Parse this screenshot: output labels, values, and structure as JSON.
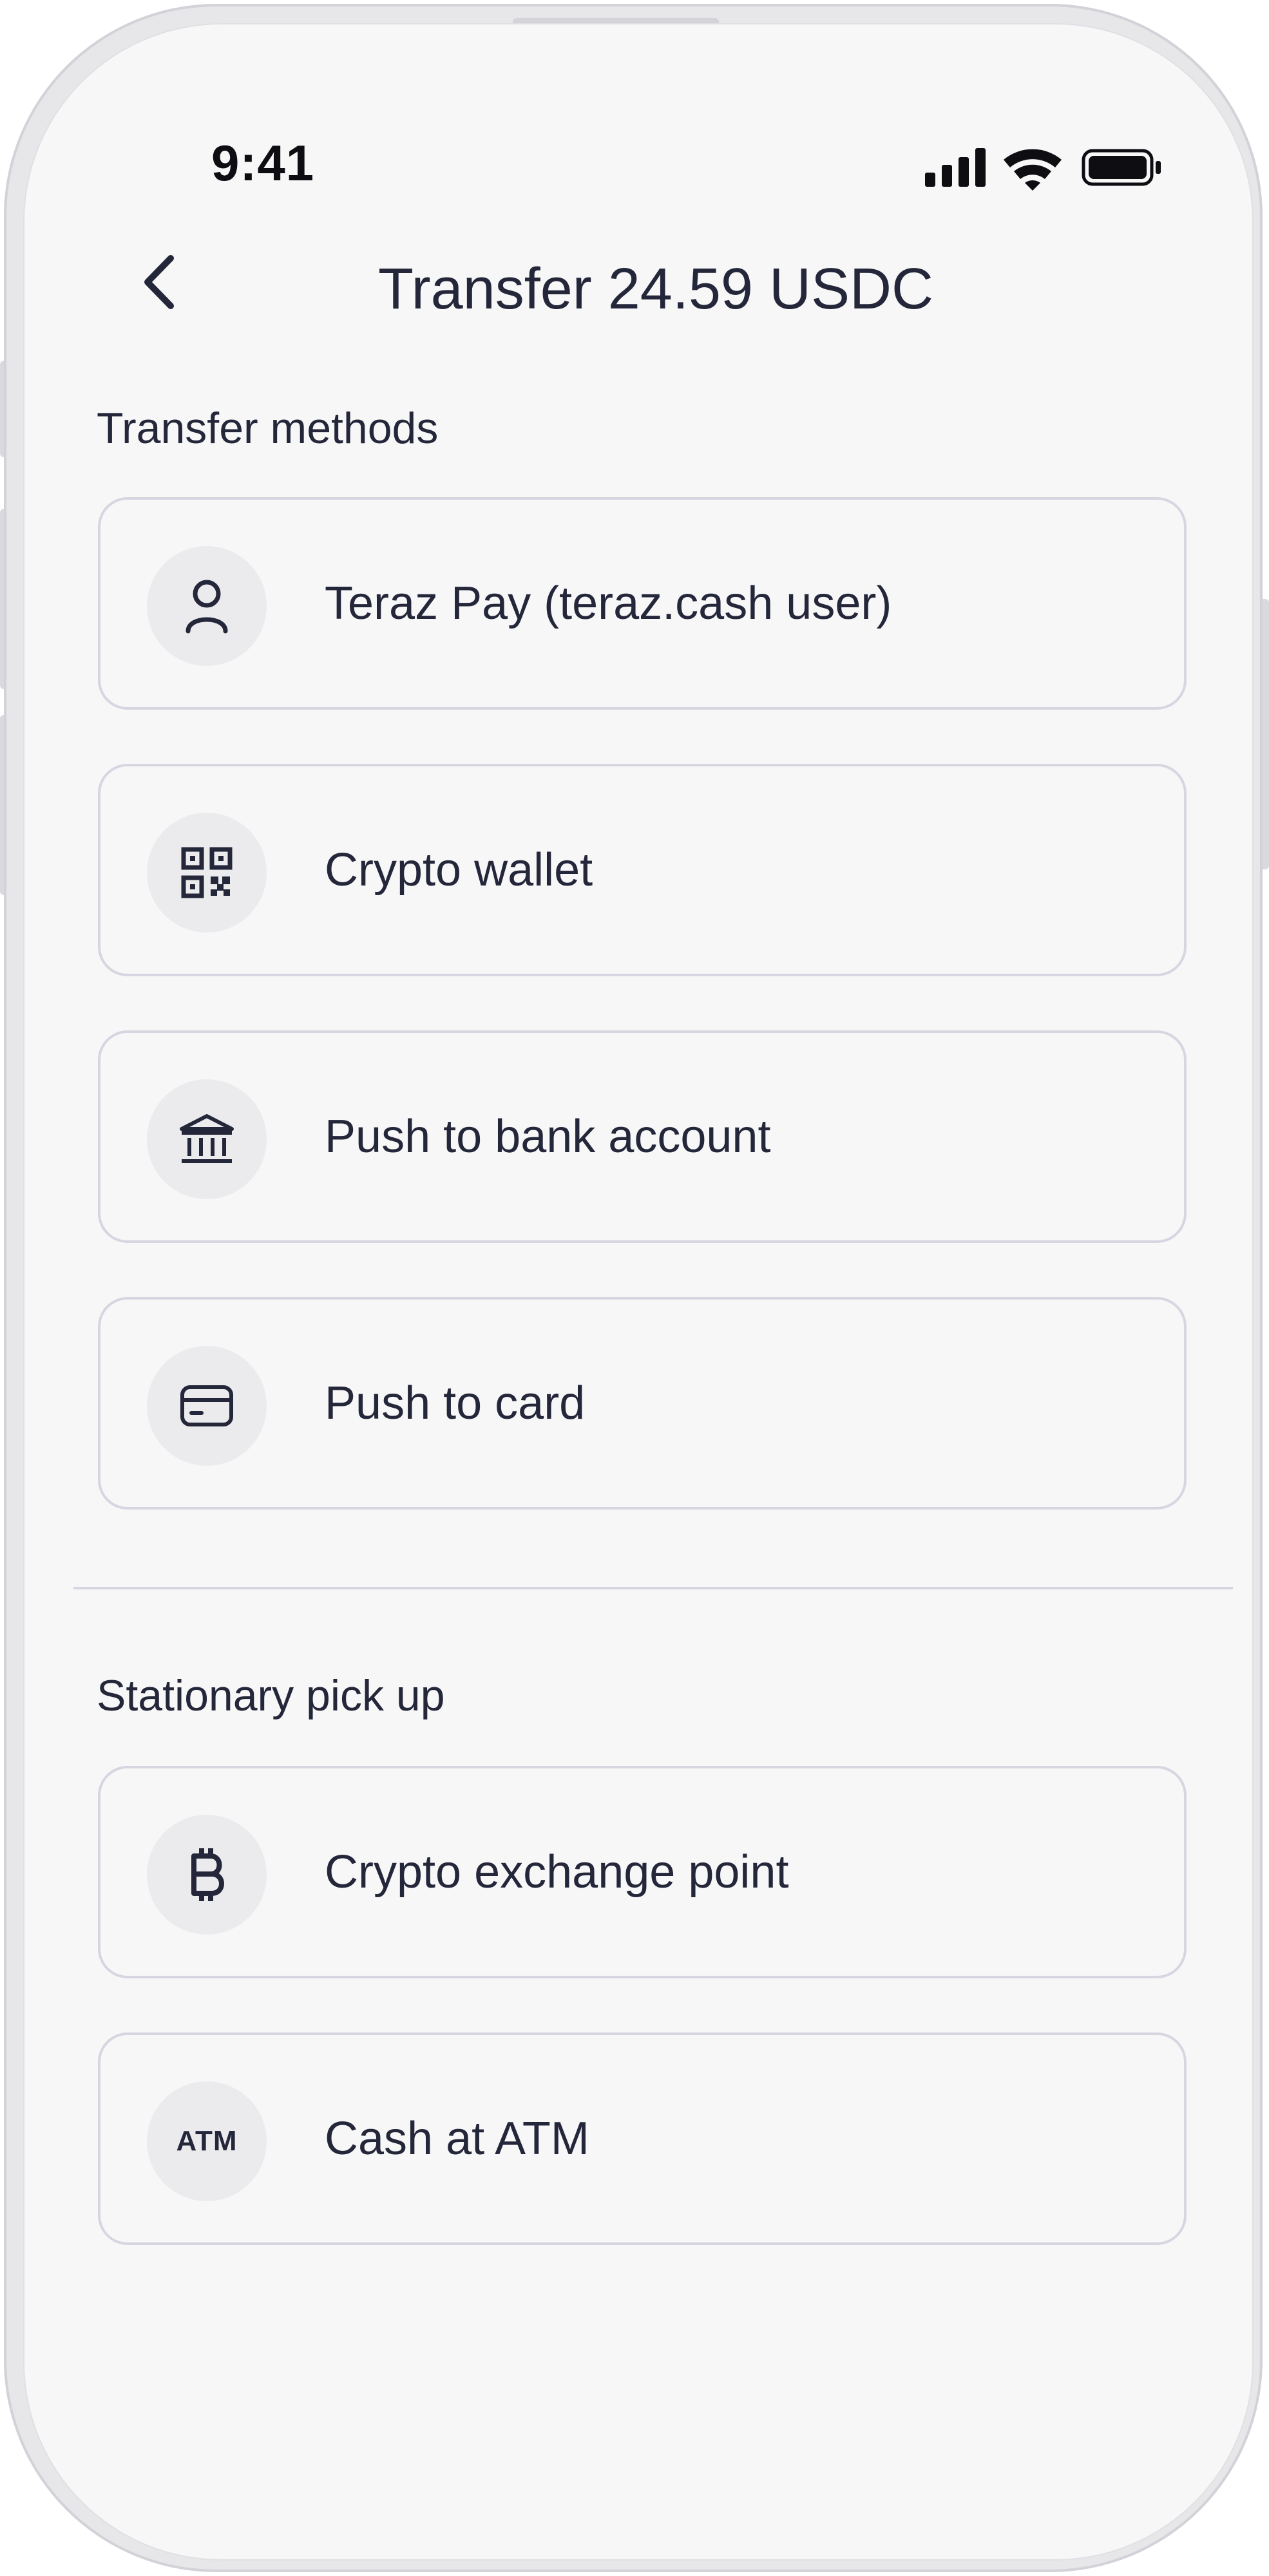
{
  "status_bar": {
    "time": "9:41"
  },
  "header": {
    "title": "Transfer 24.59 USDC"
  },
  "sections": {
    "transfer_methods": {
      "label": "Transfer methods",
      "options": [
        {
          "label": "Teraz Pay (teraz.cash user)",
          "icon": "user-icon"
        },
        {
          "label": "Crypto wallet",
          "icon": "qr-code-icon"
        },
        {
          "label": "Push to bank account",
          "icon": "bank-icon"
        },
        {
          "label": "Push to card",
          "icon": "card-icon"
        }
      ]
    },
    "stationary_pickup": {
      "label": "Stationary pick up",
      "options": [
        {
          "label": "Crypto exchange point",
          "icon": "bitcoin-icon"
        },
        {
          "label": "Cash at ATM",
          "icon": "atm-icon",
          "icon_text": "ATM"
        }
      ]
    }
  },
  "colors": {
    "text": "#24263a",
    "screen_bg": "#f7f7f8",
    "card_border": "#d6d6e1",
    "icon_circle": "#ebebee"
  }
}
